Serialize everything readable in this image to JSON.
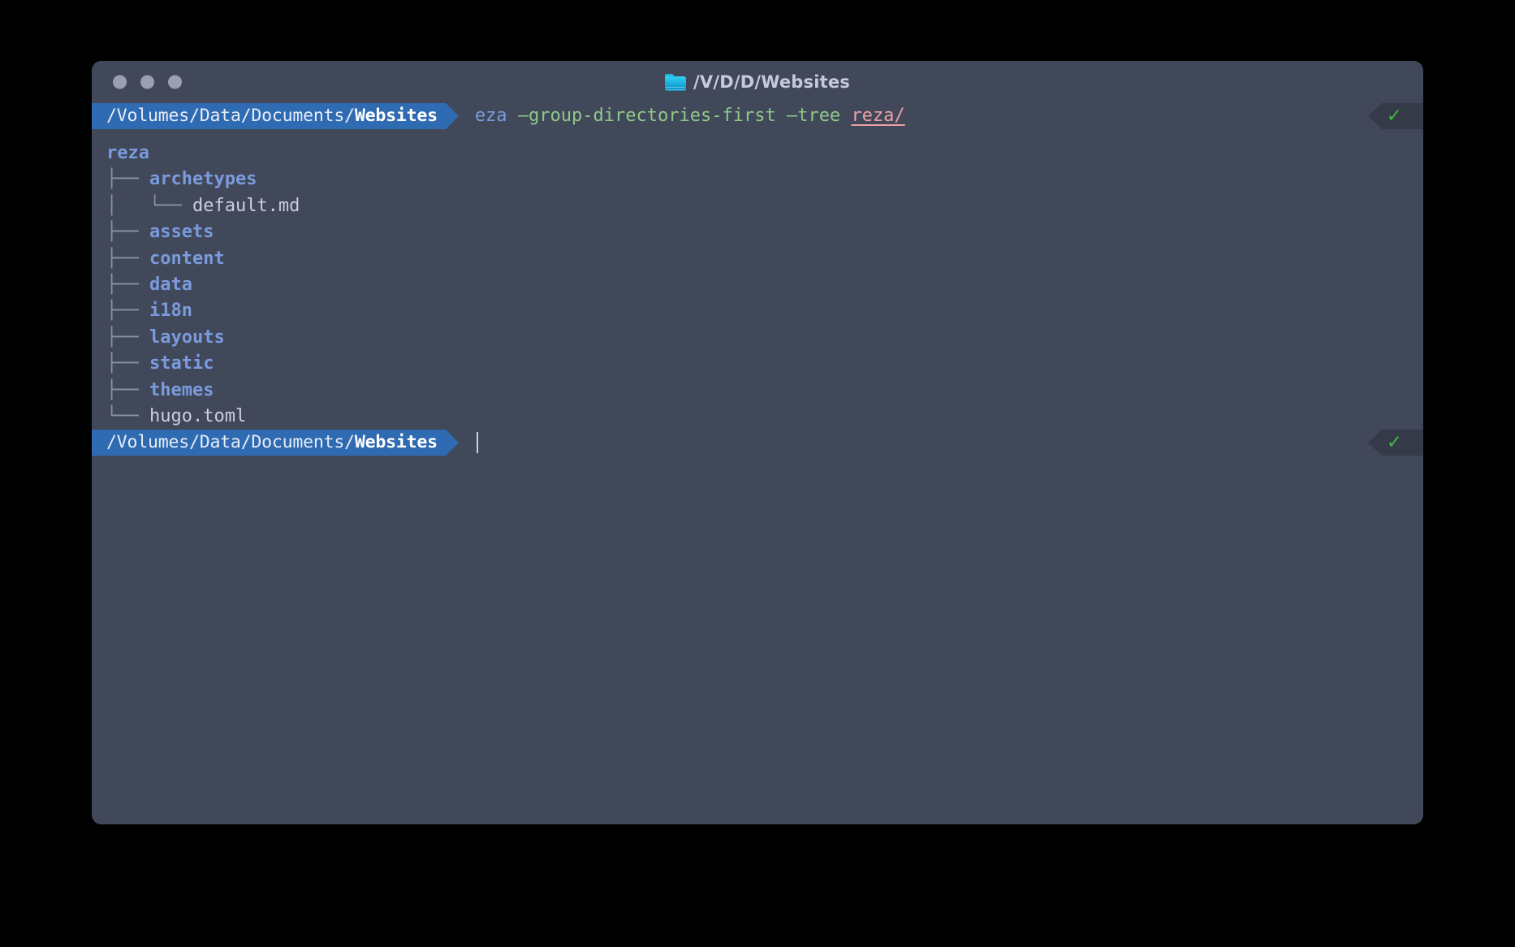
{
  "window": {
    "title": "/V/D/D/Websites",
    "title_icon": "folder-icon",
    "traffic_lights": [
      "close-button",
      "minimize-button",
      "zoom-button"
    ]
  },
  "colors": {
    "window_background": "#414859",
    "prompt_segment": "#2f6bb3",
    "status_pill": "#353a48",
    "status_check": "#3fb73f",
    "directory_blue": "#7a9bdd",
    "flag_green": "#8fc88a",
    "path_pink": "#eba0a8",
    "text_default": "#c9cfdd",
    "tree_glyph": "#8b92a3",
    "desktop_background": "#000000"
  },
  "prompt_top": {
    "path_prefix": "/Volumes/Data/Documents/",
    "path_current": "Websites",
    "status": "✓"
  },
  "command": {
    "program": "eza",
    "flag_1": "—group-directories-first",
    "flag_2": "—tree",
    "argument": "reza/"
  },
  "prompt_bottom": {
    "path_prefix": "/Volumes/Data/Documents/",
    "path_current": "Websites",
    "status": "✓",
    "input_value": ""
  },
  "tree_output": [
    {
      "glyph": "",
      "name": "reza",
      "kind": "dir"
    },
    {
      "glyph": "├── ",
      "name": "archetypes",
      "kind": "dir"
    },
    {
      "glyph": "│   └── ",
      "name": "default.md",
      "kind": "file"
    },
    {
      "glyph": "├── ",
      "name": "assets",
      "kind": "dir"
    },
    {
      "glyph": "├── ",
      "name": "content",
      "kind": "dir"
    },
    {
      "glyph": "├── ",
      "name": "data",
      "kind": "dir"
    },
    {
      "glyph": "├── ",
      "name": "i18n",
      "kind": "dir"
    },
    {
      "glyph": "├── ",
      "name": "layouts",
      "kind": "dir"
    },
    {
      "glyph": "├── ",
      "name": "static",
      "kind": "dir"
    },
    {
      "glyph": "├── ",
      "name": "themes",
      "kind": "dir"
    },
    {
      "glyph": "└── ",
      "name": "hugo.toml",
      "kind": "file"
    }
  ]
}
